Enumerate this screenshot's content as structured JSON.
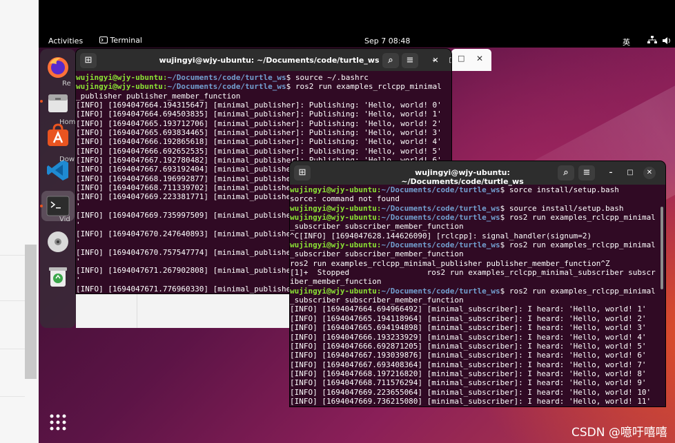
{
  "topbar": {
    "activities": "Activities",
    "app": "Terminal",
    "clock": "Sep 7  08:48",
    "ime": "英"
  },
  "dock": {
    "items": [
      {
        "name": "firefox-icon"
      },
      {
        "name": "files-icon"
      },
      {
        "name": "app-center-icon"
      },
      {
        "name": "vscode-icon"
      },
      {
        "name": "terminal-icon"
      },
      {
        "name": "disc-icon"
      },
      {
        "name": "trash-icon"
      }
    ],
    "faded_labels": [
      "Re",
      "Hom",
      "Dow",
      "Vid"
    ]
  },
  "window1": {
    "title": "wujingyi@wjy-ubuntu: ~/Documents/code/turtle_ws",
    "lines": [
      {
        "user": "wujingyi@wjy-ubuntu:",
        "path": "~/Documents/code/turtle_ws",
        "cmd": "$ source ~/.bashrc"
      },
      {
        "user": "wujingyi@wjy-ubuntu:",
        "path": "~/Documents/code/turtle_ws",
        "cmd": "$ ros2 run examples_rclcpp_minimal"
      },
      {
        "text": "_publisher publisher_member_function"
      },
      {
        "text": "[INFO] [1694047664.194315647] [minimal_publisher]: Publishing: 'Hello, world! 0'"
      },
      {
        "text": "[INFO] [1694047664.694503835] [minimal_publisher]: Publishing: 'Hello, world! 1'"
      },
      {
        "text": "[INFO] [1694047665.193712706] [minimal_publisher]: Publishing: 'Hello, world! 2'"
      },
      {
        "text": "[INFO] [1694047665.693834465] [minimal_publisher]: Publishing: 'Hello, world! 3'"
      },
      {
        "text": "[INFO] [1694047666.192865618] [minimal_publisher]: Publishing: 'Hello, world! 4'"
      },
      {
        "text": "[INFO] [1694047666.692652535] [minimal_publisher]: Publishing: 'Hello, world! 5'"
      },
      {
        "text": "[INFO] [1694047667.192780482] [minimal_publisher]: Publishing: 'Hello, world! 6'"
      },
      {
        "text": "[INFO] [1694047667.693192404] [minimal_publishe"
      },
      {
        "text": "[INFO] [1694047668.196992877] [minimal_publishe"
      },
      {
        "text": "[INFO] [1694047668.711339702] [minimal_publishe"
      },
      {
        "text": "[INFO] [1694047669.223381771] [minimal_publishe"
      },
      {
        "text": "'"
      },
      {
        "text": "[INFO] [1694047669.735997509] [minimal_publishe"
      },
      {
        "text": "'"
      },
      {
        "text": "[INFO] [1694047670.247640893] [minimal_publishe"
      },
      {
        "text": "'"
      },
      {
        "text": "[INFO] [1694047670.757547774] [minimal_publishe"
      },
      {
        "text": "'"
      },
      {
        "text": "[INFO] [1694047671.267902808] [minimal_publishe"
      },
      {
        "text": "'"
      },
      {
        "text": "[INFO] [1694047671.776960330] [minimal_publishe"
      }
    ]
  },
  "window2": {
    "title": "wujingyi@wjy-ubuntu: ~/Documents/code/turtle_ws",
    "lines": [
      {
        "user": "wujingyi@wjy-ubuntu:",
        "path": "~/Documents/code/turtle_ws",
        "cmd": "$ sorce install/setup.bash"
      },
      {
        "text": "sorce: command not found"
      },
      {
        "user": "wujingyi@wjy-ubuntu:",
        "path": "~/Documents/code/turtle_ws",
        "cmd": "$ source install/setup.bash"
      },
      {
        "user": "wujingyi@wjy-ubuntu:",
        "path": "~/Documents/code/turtle_ws",
        "cmd": "$ ros2 run examples_rclcpp_minimal"
      },
      {
        "text": "_subscriber subscriber_member_function"
      },
      {
        "text": "^C[INFO] [1694047628.144626090] [rclcpp]: signal_handler(signum=2)"
      },
      {
        "user": "wujingyi@wjy-ubuntu:",
        "path": "~/Documents/code/turtle_ws",
        "cmd": "$ ros2 run examples_rclcpp_minimal"
      },
      {
        "text": "_subscriber subscriber_member_function"
      },
      {
        "text": "ros2 run examples_rclcpp_minimal_publisher publisher_member_function^Z"
      },
      {
        "text": "[1]+  Stopped                 ros2 run examples_rclcpp_minimal_subscriber subscr"
      },
      {
        "text": "iber_member_function"
      },
      {
        "user": "wujingyi@wjy-ubuntu:",
        "path": "~/Documents/code/turtle_ws",
        "cmd": "$ ros2 run examples_rclcpp_minimal"
      },
      {
        "text": "_subscriber subscriber_member_function"
      },
      {
        "text": "[INFO] [1694047664.694966492] [minimal_subscriber]: I heard: 'Hello, world! 1'"
      },
      {
        "text": "[INFO] [1694047665.194118964] [minimal_subscriber]: I heard: 'Hello, world! 2'"
      },
      {
        "text": "[INFO] [1694047665.694194898] [minimal_subscriber]: I heard: 'Hello, world! 3'"
      },
      {
        "text": "[INFO] [1694047666.193233929] [minimal_subscriber]: I heard: 'Hello, world! 4'"
      },
      {
        "text": "[INFO] [1694047666.692871205] [minimal_subscriber]: I heard: 'Hello, world! 5'"
      },
      {
        "text": "[INFO] [1694047667.193039876] [minimal_subscriber]: I heard: 'Hello, world! 6'"
      },
      {
        "text": "[INFO] [1694047667.693408364] [minimal_subscriber]: I heard: 'Hello, world! 7'"
      },
      {
        "text": "[INFO] [1694047668.197216820] [minimal_subscriber]: I heard: 'Hello, world! 8'"
      },
      {
        "text": "[INFO] [1694047668.711576294] [minimal_subscriber]: I heard: 'Hello, world! 9'"
      },
      {
        "text": "[INFO] [1694047669.223655064] [minimal_subscriber]: I heard: 'Hello, world! 10'"
      },
      {
        "text": "[INFO] [1694047669.736215080] [minimal_subscriber]: I heard: 'Hello, world! 11'"
      }
    ]
  },
  "watermark": "CSDN @噫吁嘻嘻嘻嘻"
}
